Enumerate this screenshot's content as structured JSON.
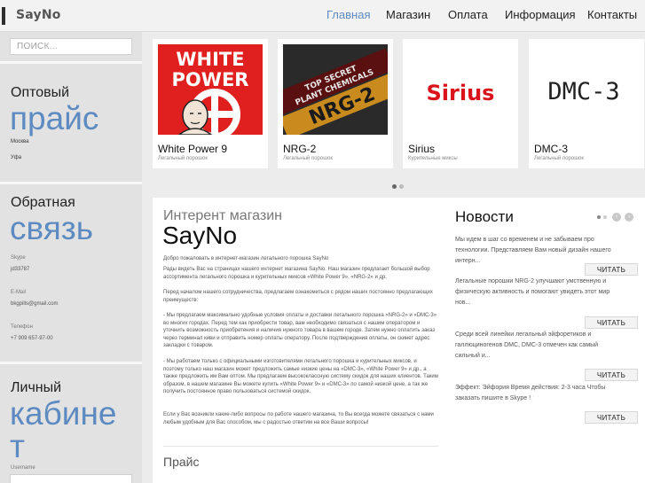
{
  "header": {
    "logo": "SayNo",
    "nav": [
      "Главная",
      "Магазин",
      "Оплата",
      "Информация",
      "Контакты"
    ]
  },
  "sidebar": {
    "search_placeholder": "ПОИСК...",
    "wholesale": {
      "title": "Оптовый",
      "big": "прайс",
      "cities": [
        "Москва",
        "Уфа"
      ]
    },
    "feedback": {
      "title": "Обратная",
      "big": "связь",
      "skype_label": "Skype",
      "skype_value": "jd33787",
      "email_label": "E-Mail",
      "email_value": "bkgpills@gmail.com",
      "phone_label": "Телефон",
      "phone_value": "+7 909 657-97-00"
    },
    "account": {
      "title": "Личный",
      "big_line1": "кабине",
      "big_line2": "т",
      "username_label": "Username"
    }
  },
  "products": [
    {
      "title": "White Power 9",
      "subtitle": "Легальный порошок",
      "art_line1": "WHITE",
      "art_line2": "POWER"
    },
    {
      "title": "NRG-2",
      "subtitle": "Легальный порошок",
      "art_line1": "TOP SECRET",
      "art_line2": "PLANT CHEMICALS",
      "art_line3": "NRG-2"
    },
    {
      "title": "Sirius",
      "subtitle": "Курительные миксы",
      "art_line1": "Sirius"
    },
    {
      "title": "DMC-3",
      "subtitle": "Легальный порошок",
      "art_line1": "DMC-3"
    }
  ],
  "content": {
    "intro": "Интерент магазин",
    "brand": "SayNo",
    "paragraphs": [
      "Добро пожаловать в интернет-магазин легального порошка SayNo",
      "Рады видеть Вас на страницах нашего интернет магазина SayNo. Наш магазин предлагает большой выбор ассортимента легального порошка и курительных миксов «White Power 9», «NRG-2» и др.",
      "Перед началом нашего сотрудничества, предлагаем ознакомиться с рядом наших постоянно предлагающих преимуществ:",
      "- Мы предлагаем максимально удобные условия оплаты и доставки легального порошка «NRG-2» и «DMC-3» во многих городах. Перед тем как приобрести товар, вам необходимо связаться с нашим оператором и уточнить возможность приобретения и наличия нужного товара в вашем городе. Затем нужно оплатить заказ через терминал киви и отправить номер оплаты оператору. После подтверждения оплаты, он скинет адрес закладки с товаром.",
      "- Мы работаем только с официальными изготовителями легального порошка и курительных миксов, и поэтому только наш магазин может предложить самые низкие цены на «DMC-3», «White Power 9» и др., а также предложить им Вам оптом. Мы предлагаем высококлассную систему скидок для наших клиентов. Таким образом, в нашем магазине Вы можете купить «White Power 9» и «DMC-3» по самой низкой цене, а так же получить постоянное право пользоваться системой скидок.",
      "Если у Вас возникли какие-либо вопросы по работе нашего магазина, то Вы всегда можете связаться с нами любым удобным для Вас способом, мы с радостью ответим на все Ваши вопросы!"
    ],
    "price_heading": "Прайс"
  },
  "news": {
    "heading": "Новости",
    "button_label": "ЧИТАТЬ",
    "items": [
      "Мы идем в шаг со временем и не забываем про технологии. Представляем Вам новый дизайн нашего интерн...",
      "Легальные порошки NRG-2 улучшают умственную и физическую активность и помогают увидеть этот мир нов...",
      "Среди всей линейки легальный эйфоретиков и галлюциногенов DMC, DMC-3 отмечен как самый сильный и...",
      "Эффект: Эйфория Время действия: 2-3 часа Чтобы заказать пишите в Skype !"
    ]
  },
  "colors": {
    "accent": "#5d8bc1",
    "red": "#e0201e",
    "sirius_red": "#d9141a",
    "dark": "#2b2b2b"
  }
}
